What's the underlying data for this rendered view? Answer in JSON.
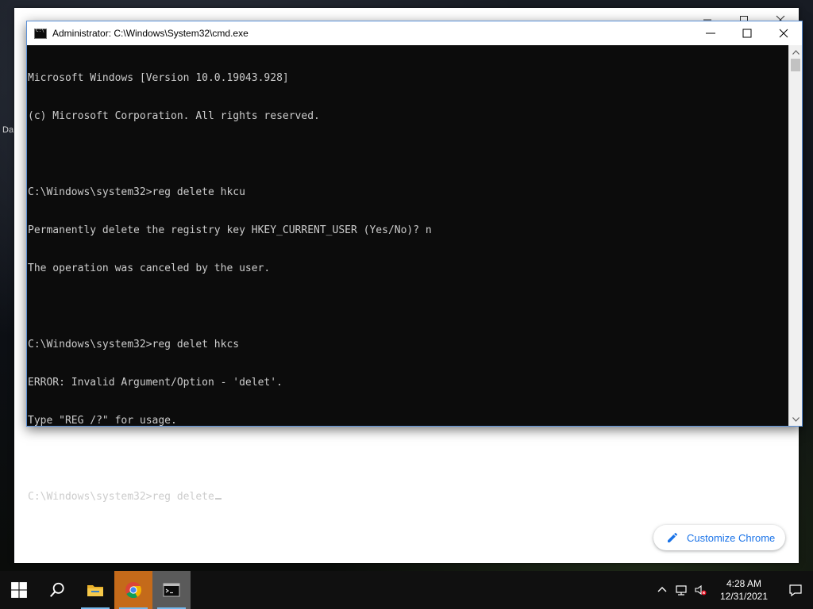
{
  "desktop": {
    "label_1": "Da"
  },
  "chrome": {
    "customize_label": "Customize Chrome",
    "accent_color": "#1a73e8"
  },
  "cmd": {
    "title": "Administrator: C:\\Windows\\System32\\cmd.exe",
    "lines": [
      "Microsoft Windows [Version 10.0.19043.928]",
      "(c) Microsoft Corporation. All rights reserved.",
      "",
      "C:\\Windows\\system32>reg delete hkcu",
      "Permanently delete the registry key HKEY_CURRENT_USER (Yes/No)? n",
      "The operation was canceled by the user.",
      "",
      "C:\\Windows\\system32>reg delet hkcs",
      "ERROR: Invalid Argument/Option - 'delet'.",
      "Type \"REG /?\" for usage.",
      "",
      "C:\\Windows\\system32>reg delete"
    ],
    "text_color": "#cccccc",
    "background_color": "#0c0c0c",
    "window_buttons": [
      "minimize-icon",
      "maximize-icon",
      "close-icon"
    ]
  },
  "taskbar": {
    "apps": [
      {
        "name": "start",
        "icon": "windows-logo-icon"
      },
      {
        "name": "search",
        "icon": "search-icon"
      },
      {
        "name": "file-explorer",
        "icon": "folder-icon"
      },
      {
        "name": "chrome",
        "icon": "chrome-icon"
      },
      {
        "name": "cmd",
        "icon": "cmd-icon"
      }
    ],
    "clock": {
      "time": "4:28 AM",
      "date": "12/31/2021"
    },
    "tray_icons": [
      "chevron-up-icon",
      "network-icon",
      "volume-muted-icon",
      "notification-icon"
    ]
  }
}
